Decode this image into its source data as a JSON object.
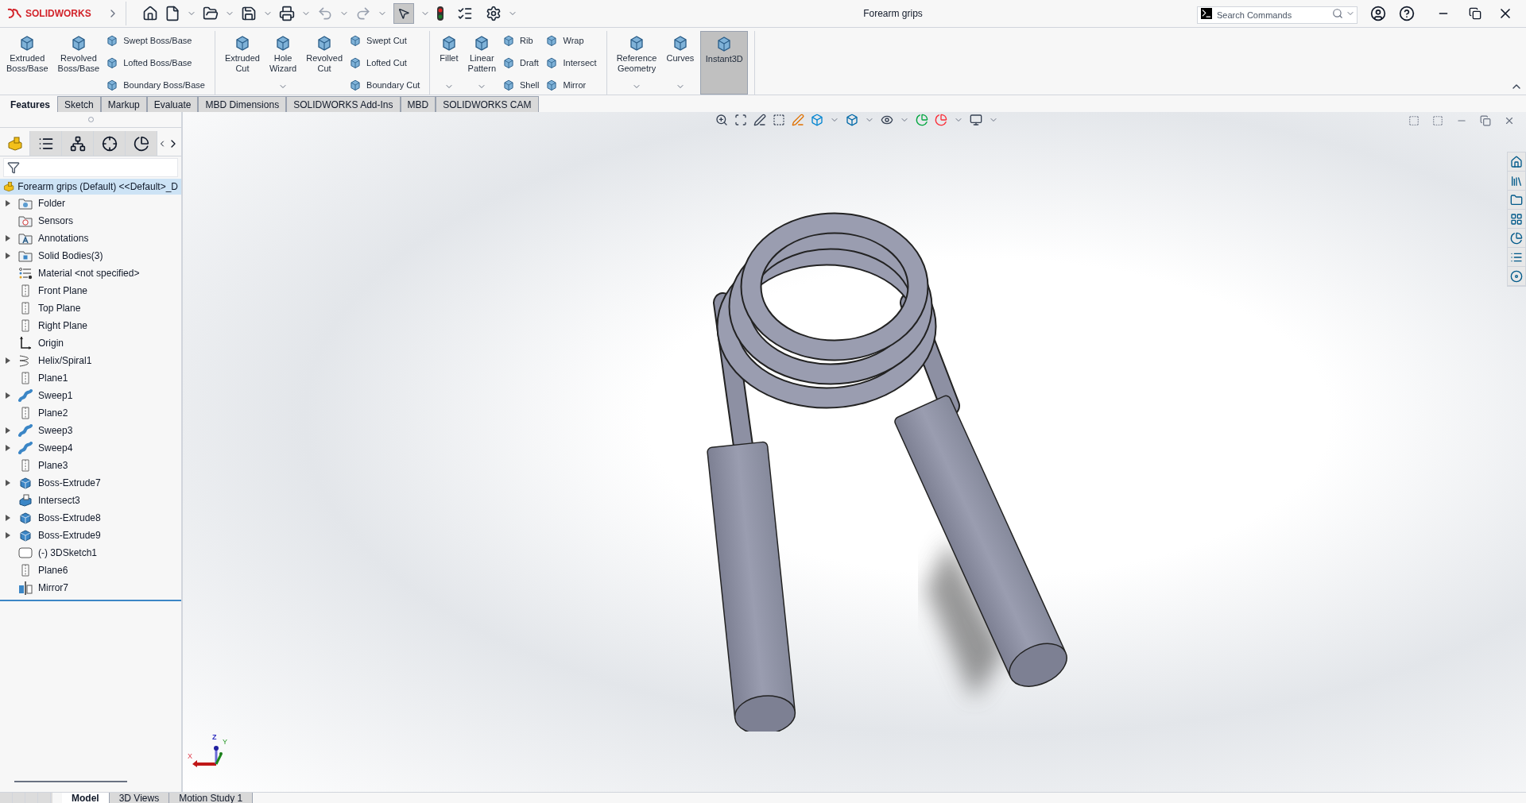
{
  "window": {
    "title": "Forearm grips",
    "brand": "SOLIDWORKS"
  },
  "search": {
    "placeholder": "Search Commands"
  },
  "ribbon": {
    "groups": [
      {
        "items": [
          {
            "kind": "large",
            "label": "Extruded\nBoss/Base",
            "dropdown": false,
            "selected": false
          },
          {
            "kind": "large",
            "label": "Revolved\nBoss/Base",
            "dropdown": false,
            "selected": false
          },
          {
            "kind": "stack",
            "labels": [
              "Swept Boss/Base",
              "Lofted Boss/Base",
              "Boundary Boss/Base"
            ]
          }
        ]
      },
      {
        "items": [
          {
            "kind": "large",
            "label": "Extruded\nCut",
            "dropdown": false,
            "selected": false
          },
          {
            "kind": "large",
            "label": "Hole\nWizard",
            "dropdown": true,
            "selected": false
          },
          {
            "kind": "large",
            "label": "Revolved\nCut",
            "dropdown": false,
            "selected": false
          },
          {
            "kind": "stack",
            "labels": [
              "Swept Cut",
              "Lofted Cut",
              "Boundary Cut"
            ]
          }
        ]
      },
      {
        "items": [
          {
            "kind": "large",
            "label": "Fillet",
            "dropdown": true,
            "selected": false
          },
          {
            "kind": "large",
            "label": "Linear\nPattern",
            "dropdown": true,
            "selected": false
          },
          {
            "kind": "stack",
            "labels": [
              "Rib",
              "Draft",
              "Shell"
            ]
          },
          {
            "kind": "stack",
            "labels": [
              "Wrap",
              "Intersect",
              "Mirror"
            ]
          }
        ]
      },
      {
        "items": [
          {
            "kind": "large",
            "label": "Reference\nGeometry",
            "dropdown": true,
            "selected": false
          },
          {
            "kind": "large",
            "label": "Curves",
            "dropdown": true,
            "selected": false
          },
          {
            "kind": "large",
            "label": "Instant3D",
            "dropdown": false,
            "selected": true
          }
        ]
      }
    ]
  },
  "command_tabs": [
    {
      "label": "Features",
      "selected": true
    },
    {
      "label": "Sketch",
      "selected": false
    },
    {
      "label": "Markup",
      "selected": false
    },
    {
      "label": "Evaluate",
      "selected": false
    },
    {
      "label": "MBD Dimensions",
      "selected": false
    },
    {
      "label": "SOLIDWORKS Add-Ins",
      "selected": false
    },
    {
      "label": "MBD",
      "selected": false
    },
    {
      "label": "SOLIDWORKS CAM",
      "selected": false
    }
  ],
  "feature_tree": {
    "root": "Forearm grips (Default) <<Default>_D",
    "items": [
      {
        "label": "Folder",
        "kind": "folder",
        "expandable": true
      },
      {
        "label": "Sensors",
        "kind": "sensor",
        "expandable": false
      },
      {
        "label": "Annotations",
        "kind": "annotation",
        "expandable": true
      },
      {
        "label": "Solid Bodies(3)",
        "kind": "bodies",
        "expandable": true
      },
      {
        "label": "Material <not specified>",
        "kind": "material",
        "expandable": false
      },
      {
        "label": "Front Plane",
        "kind": "plane",
        "expandable": false
      },
      {
        "label": "Top Plane",
        "kind": "plane",
        "expandable": false
      },
      {
        "label": "Right Plane",
        "kind": "plane",
        "expandable": false
      },
      {
        "label": "Origin",
        "kind": "origin",
        "expandable": false
      },
      {
        "label": "Helix/Spiral1",
        "kind": "helix",
        "expandable": true
      },
      {
        "label": "Plane1",
        "kind": "plane",
        "expandable": false
      },
      {
        "label": "Sweep1",
        "kind": "sweep",
        "expandable": true
      },
      {
        "label": "Plane2",
        "kind": "plane",
        "expandable": false
      },
      {
        "label": "Sweep3",
        "kind": "sweep",
        "expandable": true
      },
      {
        "label": "Sweep4",
        "kind": "sweep",
        "expandable": true
      },
      {
        "label": "Plane3",
        "kind": "plane",
        "expandable": false
      },
      {
        "label": "Boss-Extrude7",
        "kind": "extrude",
        "expandable": true
      },
      {
        "label": "Intersect3",
        "kind": "intersect",
        "expandable": false
      },
      {
        "label": "Boss-Extrude8",
        "kind": "extrude",
        "expandable": true
      },
      {
        "label": "Boss-Extrude9",
        "kind": "extrude",
        "expandable": true
      },
      {
        "label": "(-) 3DSketch1",
        "kind": "sketch3d",
        "expandable": false
      },
      {
        "label": "Plane6",
        "kind": "plane",
        "expandable": false
      },
      {
        "label": "Mirror7",
        "kind": "mirror",
        "expandable": false
      }
    ]
  },
  "triad": {
    "x": "X",
    "y": "Y",
    "z": "Z"
  },
  "bottom_tabs": [
    {
      "label": "Model",
      "selected": true
    },
    {
      "label": "3D Views",
      "selected": false
    },
    {
      "label": "Motion Study 1",
      "selected": false
    }
  ]
}
